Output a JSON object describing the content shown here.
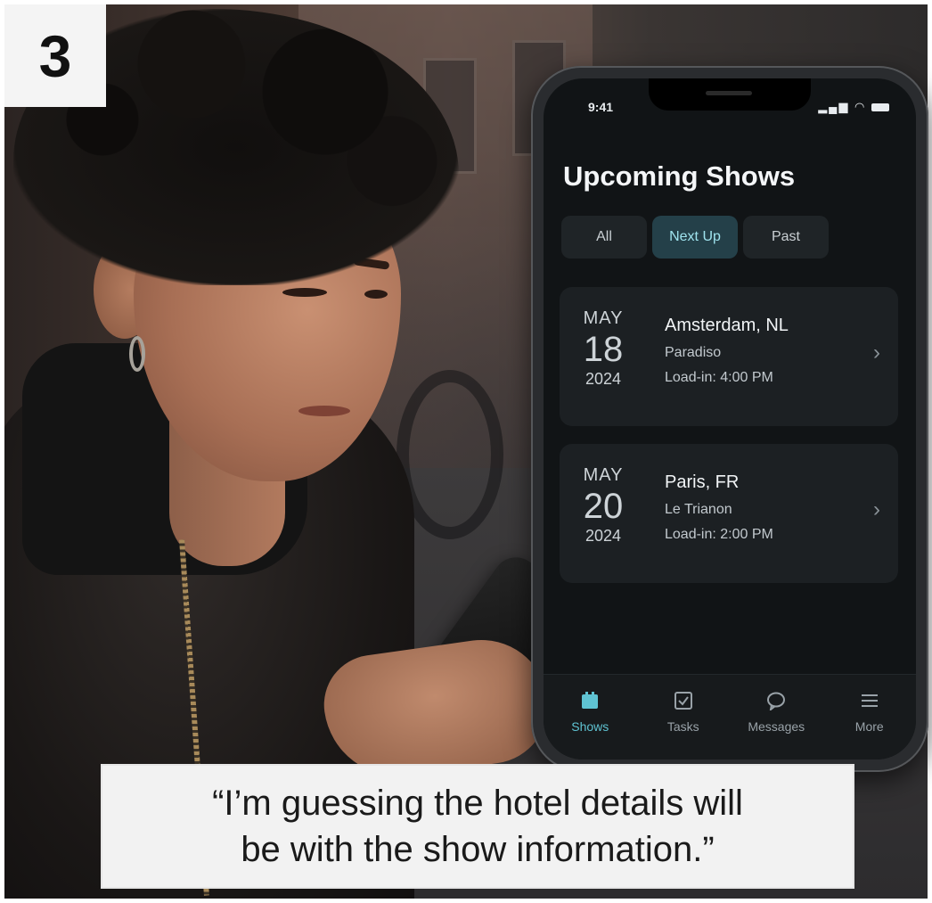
{
  "step_number": "3",
  "phone": {
    "status_time": "9:41",
    "page_title": "Upcoming Shows",
    "tabs": [
      {
        "label": "All",
        "active": false
      },
      {
        "label": "Next Up",
        "active": true
      },
      {
        "label": "Past",
        "active": false
      }
    ],
    "shows": [
      {
        "month": "MAY",
        "day": "18",
        "year": "2024",
        "city": "Amsterdam, NL",
        "venue": "Paradiso",
        "load_in": "Load-in: 4:00 PM"
      },
      {
        "month": "MAY",
        "day": "20",
        "year": "2024",
        "city": "Paris, FR",
        "venue": "Le Trianon",
        "load_in": "Load-in: 2:00 PM"
      }
    ],
    "nav": [
      {
        "label": "Shows",
        "icon": "calendar-icon",
        "active": true
      },
      {
        "label": "Tasks",
        "icon": "checkbox-icon",
        "active": false
      },
      {
        "label": "Messages",
        "icon": "chat-bubble-icon",
        "active": false
      },
      {
        "label": "More",
        "icon": "menu-icon",
        "active": false
      }
    ],
    "accent_color": "#5fc3d2"
  },
  "caption": {
    "line1": "“I’m guessing the hotel details will",
    "line2": "be with the show information.”"
  }
}
